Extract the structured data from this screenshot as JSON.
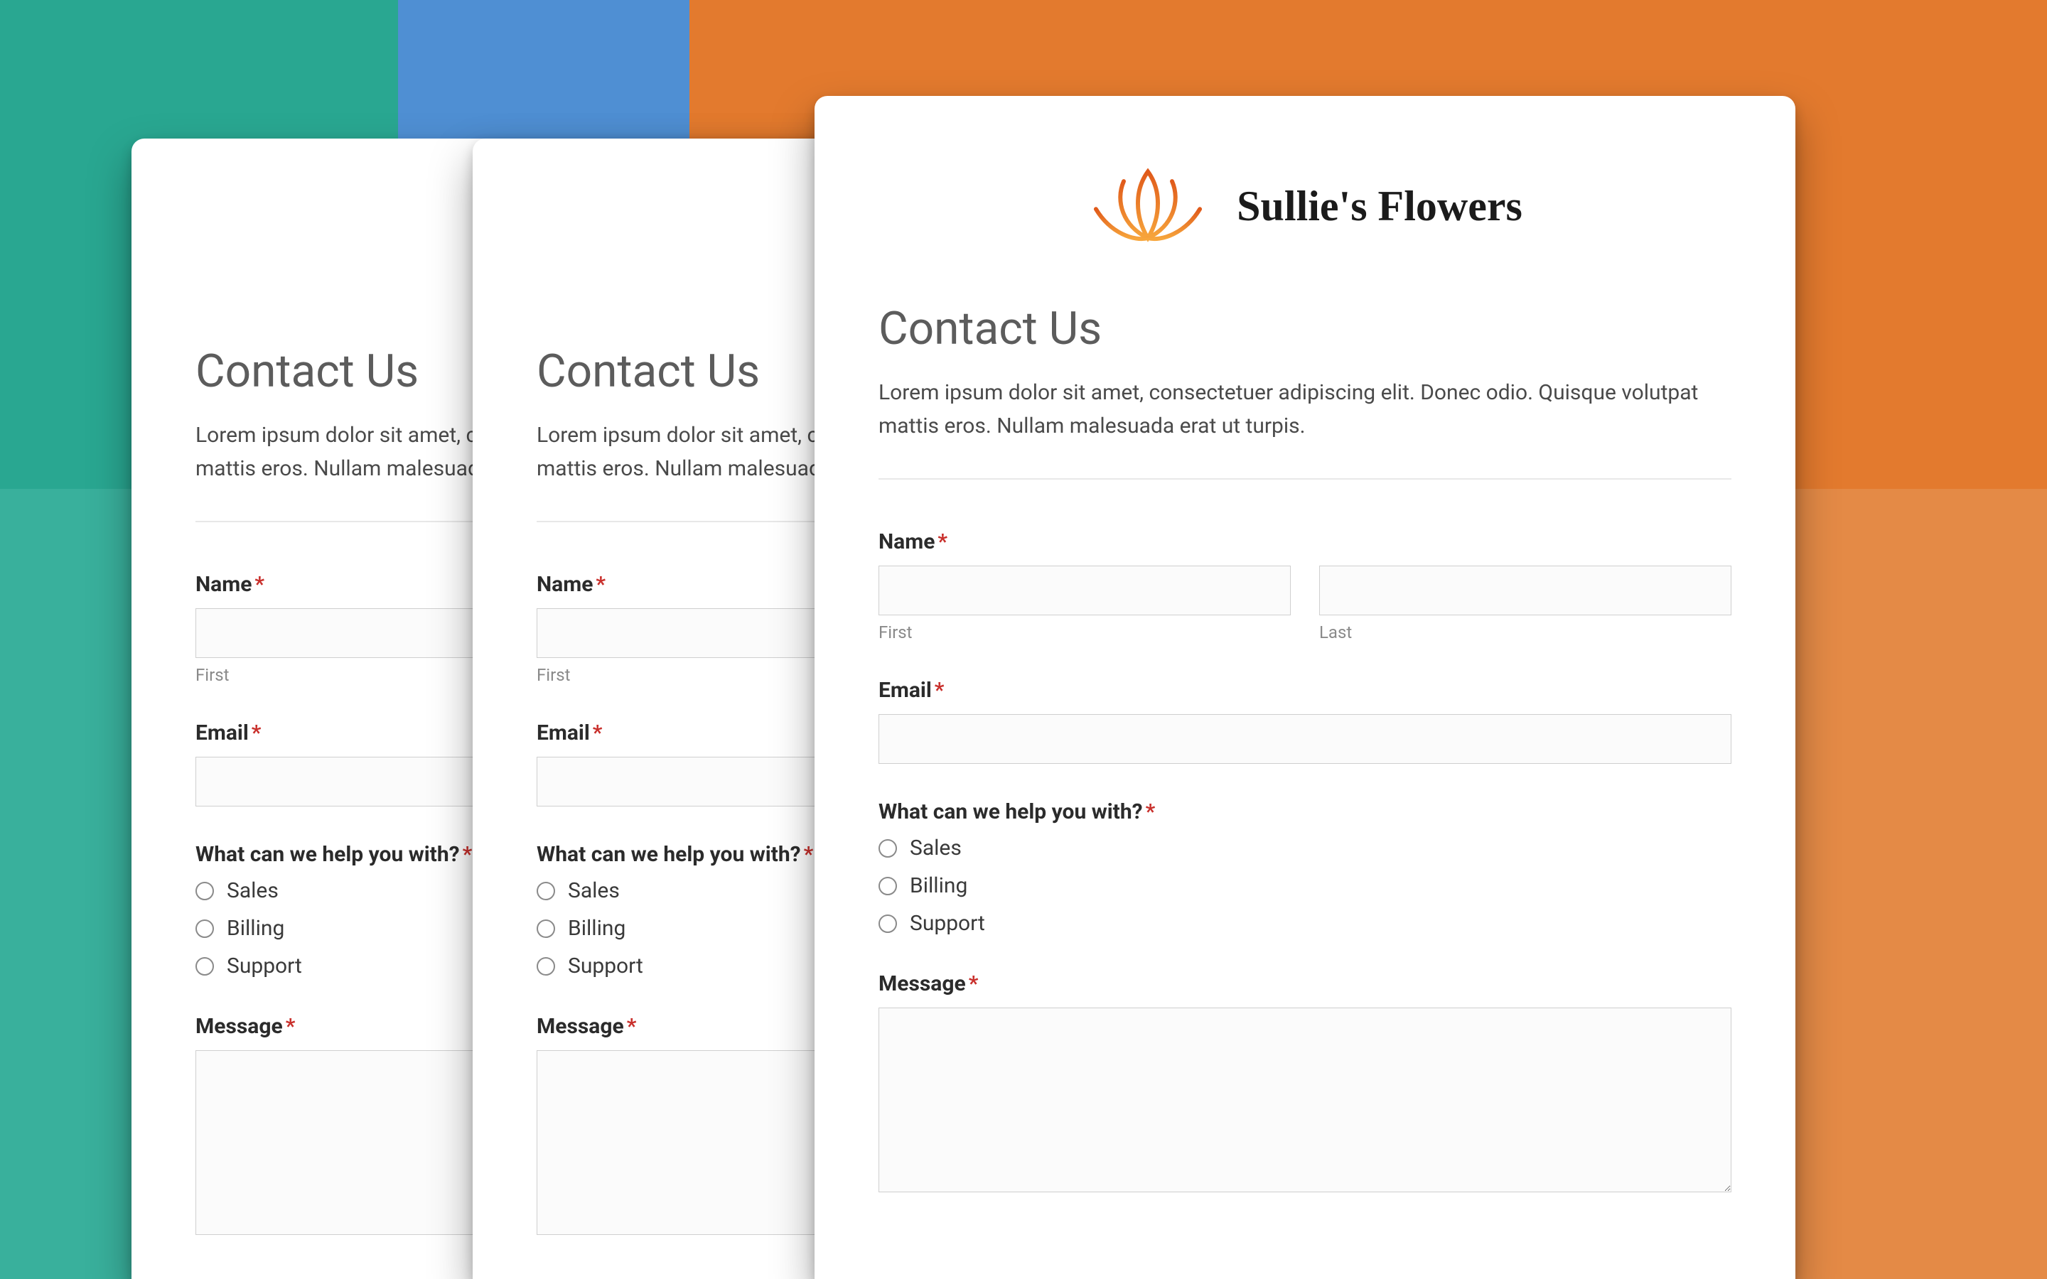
{
  "colors": {
    "teal_top": "#29a791",
    "teal_bottom": "#39b09c",
    "blue": "#4f8fd3",
    "orange_top": "#e37a2e",
    "orange_bottom": "#e48a46",
    "required": "#c9302c"
  },
  "brand": {
    "name": "Sullie's Flowers",
    "logo_icon": "lotus-icon"
  },
  "form": {
    "heading": "Contact Us",
    "intro": "Lorem ipsum dolor sit amet, consectetuer adipiscing elit. Donec odio. Quisque volutpat mattis eros. Nullam malesuada erat ut turpis.",
    "name": {
      "label": "Name",
      "required_mark": "*",
      "first_sublabel": "First",
      "last_sublabel": "Last",
      "first_value": "",
      "last_value": ""
    },
    "email": {
      "label": "Email",
      "required_mark": "*",
      "value": ""
    },
    "topic": {
      "label": "What can we help you with?",
      "required_mark": "*",
      "options": [
        "Sales",
        "Billing",
        "Support"
      ]
    },
    "message": {
      "label": "Message",
      "required_mark": "*",
      "value": ""
    }
  }
}
